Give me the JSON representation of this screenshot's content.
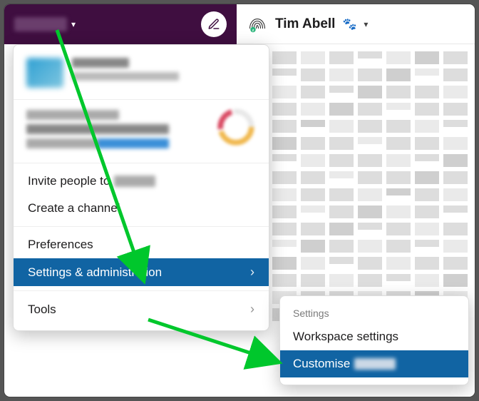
{
  "workspace": {
    "name_redacted": true
  },
  "header": {
    "name": "Tim Abell"
  },
  "menu": {
    "invite_prefix": "Invite people to",
    "create_channel": "Create a channel",
    "preferences": "Preferences",
    "settings_admin": "Settings & administration",
    "tools": "Tools"
  },
  "submenu": {
    "heading": "Settings",
    "workspace_settings": "Workspace settings",
    "customise_prefix": "Customise"
  },
  "colors": {
    "sidebar_bg": "#3f0e40",
    "selection_blue": "#1164a3",
    "annotation_green": "#00c72c"
  }
}
